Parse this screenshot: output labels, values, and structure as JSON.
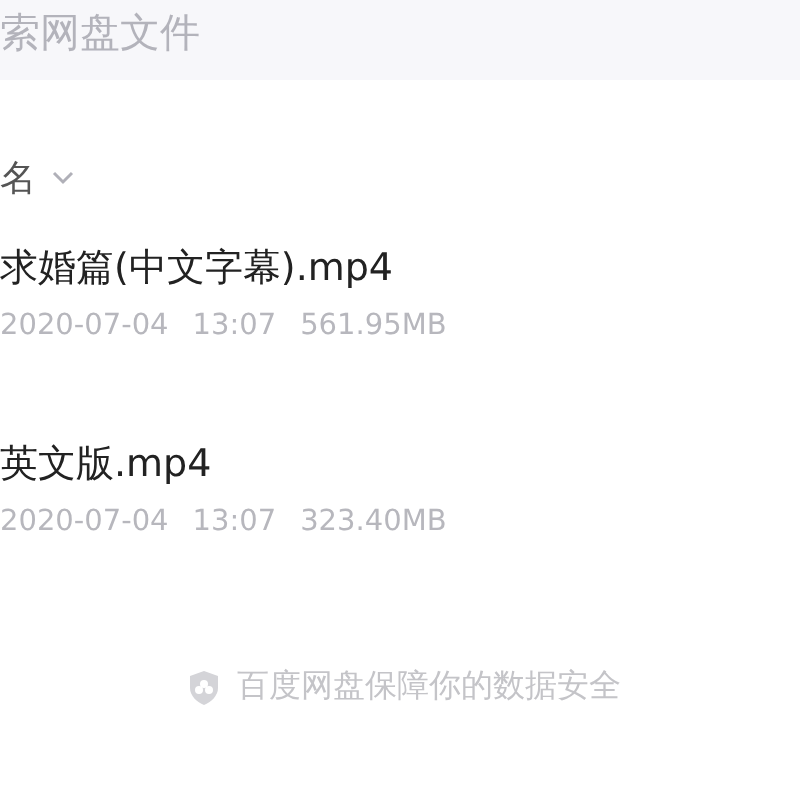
{
  "search": {
    "placeholder": "索网盘文件"
  },
  "sort": {
    "label": "名"
  },
  "files": [
    {
      "name": "求婚篇(中文字幕).mp4",
      "date": "2020-07-04",
      "time": "13:07",
      "size": "561.95MB"
    },
    {
      "name": "英文版.mp4",
      "date": "2020-07-04",
      "time": "13:07",
      "size": "323.40MB"
    }
  ],
  "footer": {
    "text": "百度网盘保障你的数据安全"
  }
}
